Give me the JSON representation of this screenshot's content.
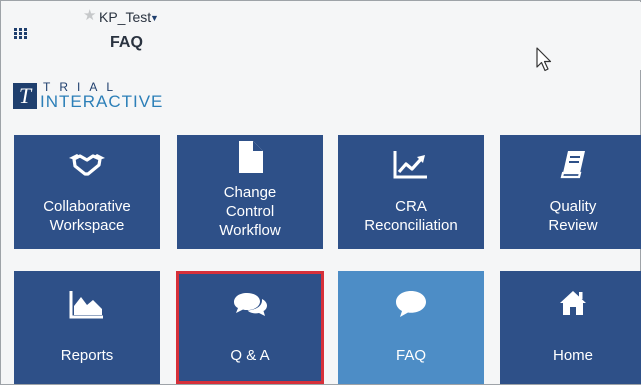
{
  "header": {
    "project": "KP_Test",
    "page_title": "FAQ"
  },
  "logo": {
    "line1": "TRIAL",
    "line2": "INTERACTIVE",
    "mark": "T"
  },
  "tiles": [
    {
      "label_lines": [
        "Collaborative",
        "Workspace"
      ],
      "icon": "handshake-icon"
    },
    {
      "label_lines": [
        "Change",
        "Control",
        "Workflow"
      ],
      "icon": "document-icon"
    },
    {
      "label_lines": [
        "CRA",
        "Reconciliation"
      ],
      "icon": "line-chart-icon"
    },
    {
      "label_lines": [
        "Quality",
        "Review"
      ],
      "icon": "book-icon"
    },
    {
      "label_lines": [
        "Reports"
      ],
      "icon": "area-chart-icon"
    },
    {
      "label_lines": [
        "Q & A"
      ],
      "icon": "comments-icon",
      "selected": true
    },
    {
      "label_lines": [
        "FAQ"
      ],
      "icon": "speech-bubble-icon",
      "active": true
    },
    {
      "label_lines": [
        "Home"
      ],
      "icon": "home-icon"
    }
  ],
  "colors": {
    "tile": "#2e5088",
    "tile_active": "#4d8dc6",
    "selection_border": "#d6303a"
  }
}
